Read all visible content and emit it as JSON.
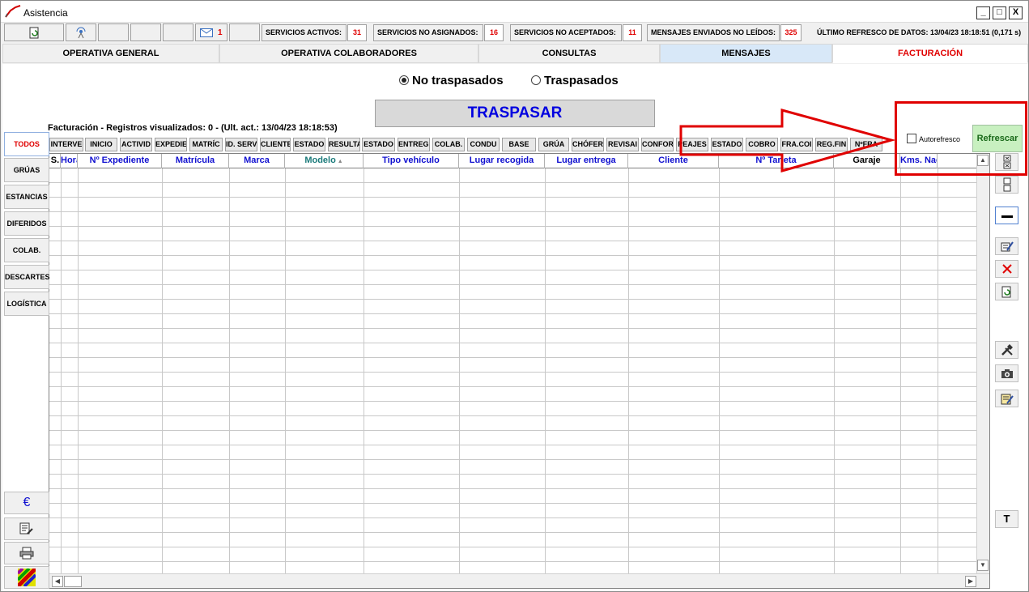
{
  "window": {
    "title": "Asistencia",
    "controls": [
      "_",
      "□",
      "X"
    ]
  },
  "toolbar": {
    "mail_count": "1",
    "stats": [
      {
        "label": "SERVICIOS ACTIVOS:",
        "value": "31"
      },
      {
        "label": "SERVICIOS NO ASIGNADOS:",
        "value": "16"
      },
      {
        "label": "SERVICIOS NO ACEPTADOS:",
        "value": "11"
      },
      {
        "label": "MENSAJES ENVIADOS NO LEÍDOS:",
        "value": "325"
      }
    ],
    "refresh_info": "ÚLTIMO REFRESCO DE DATOS: 13/04/23 18:18:51 (0,171 s)"
  },
  "tabs": [
    {
      "label": "OPERATIVA GENERAL"
    },
    {
      "label": "OPERATIVA COLABORADORES"
    },
    {
      "label": "CONSULTAS"
    },
    {
      "label": "MENSAJES"
    },
    {
      "label": "FACTURACIÓN"
    }
  ],
  "filters": {
    "option1": "No traspasados",
    "option2": "Traspasados",
    "selected": "No traspasados"
  },
  "traspasar_label": "TRASPASAR",
  "records_info": "Facturación - Registros visualizados: 0 - (Ult. act.: 13/04/23 18:18:53)",
  "filter_buttons": [
    "INTERVE",
    "INICIO",
    "ACTIVID",
    "EXPEDIE",
    "MATRÍC",
    "ID. SERV",
    "CLIENTE",
    "ESTADO",
    "RESULTA",
    "ESTADO",
    "ENTREG.",
    "COLAB.",
    "CONDU",
    "BASE",
    "GRÚA",
    "CHÓFER",
    "REVISAI",
    "CONFOR",
    "PEAJES",
    "ESTADO",
    "COBRO",
    "FRA.COI",
    "REG.FIN",
    "NºFRA"
  ],
  "autorefresh_label": "Autorefresco",
  "refrescar_label": "Refrescar",
  "grid": {
    "columns": [
      "S.",
      "Hora intervención",
      "Nº Expediente",
      "Matrícula",
      "Marca",
      "Modelo",
      "Tipo vehículo",
      "Lugar recogida",
      "Lugar entrega",
      "Cliente",
      "Nº Tarjeta",
      "Garaje",
      "Kms. Nac"
    ],
    "sorted_column": "Modelo"
  },
  "sidebar": [
    "TODOS",
    "GRÚAS",
    "ESTANCIAS",
    "DIFERIDOS",
    "COLAB.",
    "DESCARTES",
    "LOGÍSTICA"
  ],
  "sidebar_bottom_icons": [
    "euro-icon",
    "edit-list-icon",
    "print-icon",
    "color-palette-icon"
  ],
  "right_icons": [
    "expand-icon",
    "collapse-icon",
    "minus-icon",
    "edit-icon",
    "delete-icon",
    "refresh-icon",
    "tools-icon",
    "camera-icon",
    "notes-icon",
    "text-icon"
  ],
  "euro_symbol": "€",
  "text_button": "T",
  "colors": {
    "accent_red": "#e00000",
    "header_blue": "#1010d0",
    "refresh_green": "#c8f0c0"
  }
}
